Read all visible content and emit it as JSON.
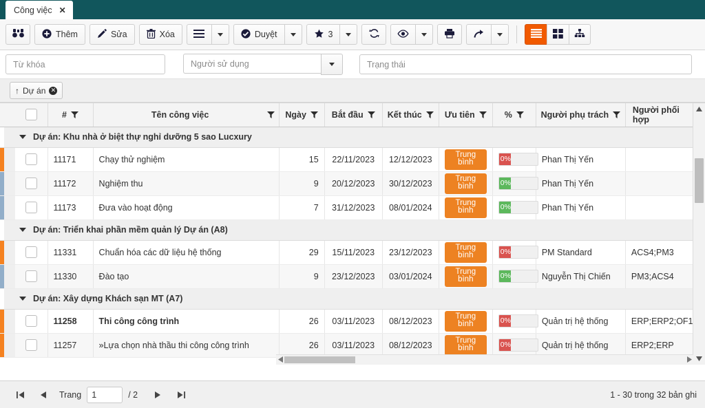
{
  "tab": {
    "label": "Công việc",
    "close": "✕"
  },
  "toolbar": {
    "search_icon": "binoculars-icon",
    "add_label": "Thêm",
    "edit_label": "Sửa",
    "delete_label": "Xóa",
    "menu_icon": "hamburger-icon",
    "approve_label": "Duyệt",
    "star_count": "3",
    "refresh_icon": "refresh-icon",
    "preview_icon": "eye-icon",
    "print_icon": "printer-icon",
    "share_icon": "share-icon",
    "view_list_icon": "list-view-icon",
    "view_grid_icon": "grid-view-icon",
    "view_tree_icon": "tree-view-icon",
    "active_accent": "#f15a00"
  },
  "filters": {
    "keyword_placeholder": "Từ khóa",
    "keyword_value": "",
    "user_placeholder": "Người sử dụng",
    "user_value": "",
    "status_placeholder": "Trạng thái",
    "status_value": ""
  },
  "chips": [
    {
      "label": "Dự án",
      "sort": "↑",
      "remove": "✕"
    }
  ],
  "grid": {
    "columns": [
      {
        "key": "check",
        "label": ""
      },
      {
        "key": "id",
        "label": "#"
      },
      {
        "key": "name",
        "label": "Tên công việc"
      },
      {
        "key": "days",
        "label": "Ngày"
      },
      {
        "key": "start",
        "label": "Bắt đầu"
      },
      {
        "key": "end",
        "label": "Kết thúc"
      },
      {
        "key": "priority",
        "label": "Ưu tiên"
      },
      {
        "key": "percent",
        "label": "%"
      },
      {
        "key": "owner",
        "label": "Người phụ trách"
      },
      {
        "key": "collab",
        "label": "Người phối hợp"
      }
    ],
    "groups": [
      {
        "title": "Dự án: Khu nhà ở biệt thự nghỉ dưỡng 5 sao Lucxury",
        "rows": [
          {
            "id": "11171",
            "name": "Chạy thử nghiệm",
            "days": "15",
            "start": "22/11/2023",
            "end": "12/12/2023",
            "priority": "Trung bình",
            "percent": "0%",
            "percent_color": "#d9534f",
            "owner": "Phan Thị Yến",
            "collab": "",
            "marker": "#f58220",
            "bold": false
          },
          {
            "id": "11172",
            "name": "Nghiệm thu",
            "days": "9",
            "start": "20/12/2023",
            "end": "30/12/2023",
            "priority": "Trung bình",
            "percent": "0%",
            "percent_color": "#5cb85c",
            "owner": "Phan Thị Yến",
            "collab": "",
            "marker": "#92aec9",
            "bold": false
          },
          {
            "id": "11173",
            "name": "Đưa vào hoạt động",
            "days": "7",
            "start": "31/12/2023",
            "end": "08/01/2024",
            "priority": "Trung bình",
            "percent": "0%",
            "percent_color": "#5cb85c",
            "owner": "Phan Thị Yến",
            "collab": "",
            "marker": "#92aec9",
            "bold": false
          }
        ]
      },
      {
        "title": "Dự án: Triển khai phần mềm quản lý Dự án (A8)",
        "rows": [
          {
            "id": "11331",
            "name": "Chuẩn hóa các dữ liệu hệ thống",
            "days": "29",
            "start": "15/11/2023",
            "end": "23/12/2023",
            "priority": "Trung bình",
            "percent": "0%",
            "percent_color": "#d9534f",
            "owner": "PM Standard",
            "collab": "ACS4;PM3",
            "marker": "#f58220",
            "bold": false
          },
          {
            "id": "11330",
            "name": "Đào tạo",
            "days": "9",
            "start": "23/12/2023",
            "end": "03/01/2024",
            "priority": "Trung bình",
            "percent": "0%",
            "percent_color": "#5cb85c",
            "owner": "Nguyễn Thị Chiến",
            "collab": "PM3;ACS4",
            "marker": "#92aec9",
            "bold": false
          }
        ]
      },
      {
        "title": "Dự án: Xây dựng Khách sạn MT (A7)",
        "rows": [
          {
            "id": "11258",
            "name": "Thi công công trình",
            "days": "26",
            "start": "03/11/2023",
            "end": "08/12/2023",
            "priority": "Trung bình",
            "percent": "0%",
            "percent_color": "#d9534f",
            "owner": "Quản trị hệ thống",
            "collab": "ERP;ERP2;OF1",
            "marker": "#f58220",
            "bold": true
          },
          {
            "id": "11257",
            "name": "»Lựa chọn nhà thầu thi công công trình",
            "days": "26",
            "start": "03/11/2023",
            "end": "08/12/2023",
            "priority": "Trung bình",
            "percent": "0%",
            "percent_color": "#d9534f",
            "owner": "Quản trị hệ thống",
            "collab": "ERP2;ERP",
            "marker": "#f58220",
            "bold": false
          }
        ]
      }
    ]
  },
  "footer": {
    "first": "⏮",
    "prev": "◀",
    "page_label": "Trang",
    "page_value": "1",
    "page_total": "/ 2",
    "next": "▶",
    "last": "⏭",
    "record_info": "1 - 30 trong 32 bản ghi"
  }
}
